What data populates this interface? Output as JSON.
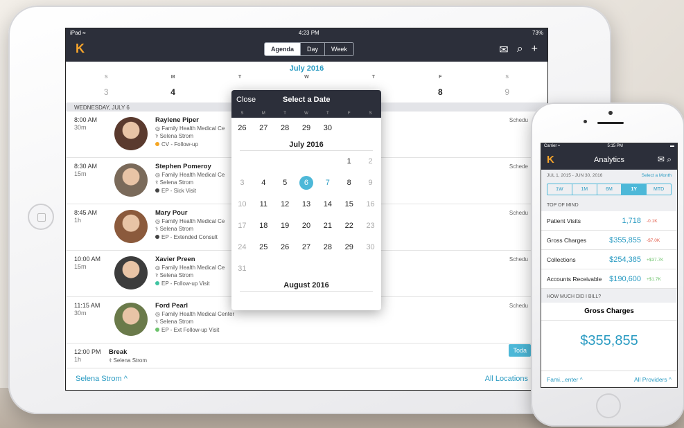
{
  "ipad": {
    "status": {
      "device": "iPad ≈",
      "time": "4:23 PM",
      "battery": "73%"
    },
    "nav": {
      "tabs": [
        "Agenda",
        "Day",
        "Week"
      ]
    },
    "month_title": "July 2016",
    "weekdays": [
      "S",
      "M",
      "T",
      "W",
      "T",
      "F",
      "S"
    ],
    "dates": [
      "3",
      "4",
      "",
      "",
      "",
      "8",
      "9"
    ],
    "day_header": "WEDNESDAY, JULY 6",
    "appointments": [
      {
        "time": "8:00 AM",
        "duration": "30m",
        "name": "Raylene Piper",
        "location": "Family Health Medical Ce",
        "provider": "Selena Strom",
        "visit": "CV - Follow-up",
        "dot": "#f5a623",
        "sched": "Schedu"
      },
      {
        "time": "8:30 AM",
        "duration": "15m",
        "name": "Stephen Pomeroy",
        "location": "Family Health Medical Ce",
        "provider": "Selena Strom",
        "visit": "EP - Sick Visit",
        "dot": "#444444",
        "sched": "Schede"
      },
      {
        "time": "8:45 AM",
        "duration": "1h",
        "name": "Mary Pour",
        "location": "Family Health Medical Ce",
        "provider": "Selena Strom",
        "visit": "EP - Extended Consult",
        "dot": "#444444",
        "sched": "Schedu"
      },
      {
        "time": "10:00 AM",
        "duration": "15m",
        "name": "Xavier Preen",
        "location": "Family Health Medical Ce",
        "provider": "Selena Strom",
        "visit": "EP - Follow-up Visit",
        "dot": "#3fc4a2",
        "sched": "Schedu"
      },
      {
        "time": "11:15 AM",
        "duration": "30m",
        "name": "Ford Pearl",
        "location": "Family Health Medical Center",
        "provider": "Selena Strom",
        "visit": "EP - Ext Follow-up Visit",
        "dot": "#6dc36c",
        "sched": "Schedu"
      }
    ],
    "break": {
      "time": "12:00 PM",
      "duration": "1h",
      "label": "Break",
      "provider": "Selena Strom"
    },
    "today_button": "Toda",
    "bottom": {
      "provider": "Selena Strom ^",
      "locations": "All Locations"
    }
  },
  "popover": {
    "close": "Close",
    "title": "Select a Date",
    "weekdays": [
      "S",
      "M",
      "T",
      "W",
      "T",
      "F",
      "S"
    ],
    "prev_row": [
      "26",
      "27",
      "28",
      "29",
      "30",
      "",
      ""
    ],
    "month": "July 2016",
    "weeks": [
      [
        "",
        "",
        "",
        "",
        "",
        "1",
        "2"
      ],
      [
        "3",
        "4",
        "5",
        "6",
        "7",
        "8",
        "9"
      ],
      [
        "10",
        "11",
        "12",
        "13",
        "14",
        "15",
        "16"
      ],
      [
        "17",
        "18",
        "19",
        "20",
        "21",
        "22",
        "23"
      ],
      [
        "24",
        "25",
        "26",
        "27",
        "28",
        "29",
        "30"
      ],
      [
        "31",
        "",
        "",
        "",
        "",
        "",
        ""
      ]
    ],
    "next_month": "August 2016"
  },
  "iphone": {
    "status": {
      "carrier": "Carrier ≈",
      "time": "5:15 PM"
    },
    "title": "Analytics",
    "range": "JUL 1, 2015 - JUN 30, 2016",
    "select_month": "Select a Month",
    "periods": [
      "1W",
      "1M",
      "6M",
      "1Y",
      "MTD"
    ],
    "top_of_mind": "TOP OF MIND",
    "metrics": [
      {
        "label": "Patient Visits",
        "value": "1,718",
        "change": "-0.1K",
        "positive": false
      },
      {
        "label": "Gross Charges",
        "value": "$355,855",
        "change": "-$7.0K",
        "positive": false
      },
      {
        "label": "Collections",
        "value": "$254,385",
        "change": "+$37.7K",
        "positive": true
      },
      {
        "label": "Accounts Receivable",
        "value": "$190,600",
        "change": "+$1.7K",
        "positive": true
      }
    ],
    "bill_section": "HOW MUCH DID I BILL?",
    "gross_title": "Gross Charges",
    "gross_value": "$355,855",
    "bottom": {
      "left": "Fami...enter ^",
      "right": "All Providers ^"
    }
  }
}
